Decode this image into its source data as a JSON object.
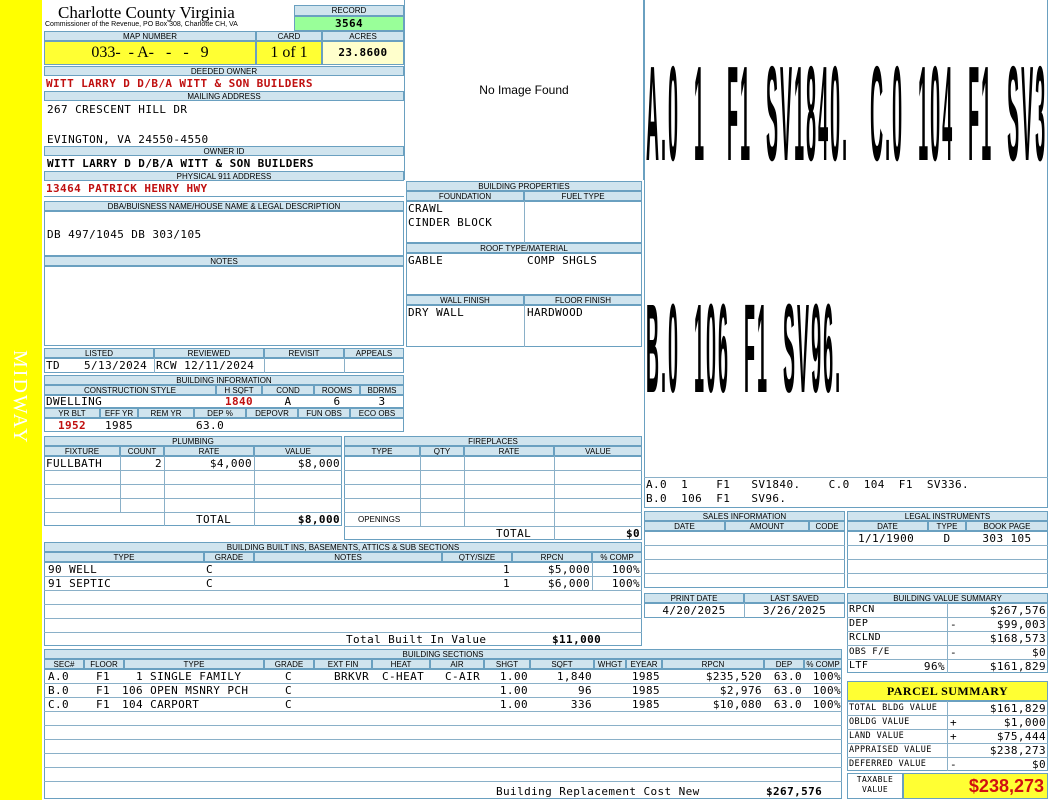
{
  "sidebar_label": "MIDWAY",
  "county_title": "Charlotte County Virginia",
  "commissioner": "Commissioner of the Revenue, PO Box 308, Charlotte CH, VA",
  "record_label": "RECORD",
  "record_value": "3564",
  "map_number_label": "MAP NUMBER",
  "map_number": "033-  - A-   -   -   9",
  "card_label": "CARD",
  "card": "1 of 1",
  "acres_label": "ACRES",
  "acres": "23.8600",
  "deeded_owner_label": "DEEDED OWNER",
  "deeded_owner": "WITT LARRY D D/B/A WITT & SON BUILDERS",
  "mailing_label": "MAILING ADDRESS",
  "mailing_line1": "267 CRESCENT HILL DR",
  "mailing_line2": "EVINGTON, VA 24550-4550",
  "owner_id_label": "OWNER ID",
  "owner_id": "WITT LARRY D D/B/A WITT & SON BUILDERS",
  "physical_label": "PHYSICAL 911 ADDRESS",
  "physical_address": "13464 PATRICK HENRY HWY",
  "dba_label": "DBA/BUISNESS NAME/HOUSE NAME & LEGAL DESCRIPTION",
  "dba_text": "DB 497/1045 DB 303/105",
  "notes_label": "NOTES",
  "no_image": "No Image Found",
  "building_properties": {
    "title": "BUILDING PROPERTIES",
    "foundation_label": "FOUNDATION",
    "fuel_label": "FUEL TYPE",
    "foundation1": "CRAWL",
    "foundation2": "CINDER BLOCK",
    "roof_label": "ROOF TYPE/MATERIAL",
    "roof_type": "GABLE",
    "roof_material": "COMP SHGLS",
    "wall_label": "WALL FINISH",
    "floor_label": "FLOOR FINISH",
    "wall": "DRY WALL",
    "floor": "HARDWOOD"
  },
  "sketch": {
    "row1": "A.0  1   F1  SV1840.   C.0  104  F1  SV336.",
    "row2": "B.0  106  F1  SV96.",
    "caption1": "A.0  1    F1   SV1840.    C.0  104  F1  SV336.",
    "caption2": "B.0  106  F1   SV96."
  },
  "review": {
    "listed_label": "LISTED",
    "reviewed_label": "REVIEWED",
    "revisit_label": "REVISIT",
    "appeals_label": "APPEALS",
    "listed_code": "TD",
    "listed_date": "5/13/2024",
    "reviewed": "RCW 12/11/2024"
  },
  "building_info": {
    "title": "BUILDING INFORMATION",
    "h_style": "CONSTRUCTION STYLE",
    "h_sqft": "H SQFT",
    "h_cond": "COND",
    "h_rooms": "ROOMS",
    "h_bdrms": "BDRMS",
    "style": "DWELLING",
    "sqft": "1840",
    "cond": "A",
    "rooms": "6",
    "bdrms": "3",
    "h_yrblt": "YR BLT",
    "h_effyr": "EFF YR",
    "h_remyr": "REM YR",
    "h_dep": "DEP %",
    "h_depovr": "DEPOVR",
    "h_funobs": "FUN OBS",
    "h_ecoobs": "ECO OBS",
    "yrblt": "1952",
    "effyr": "1985",
    "dep": "63.0"
  },
  "plumbing": {
    "title": "PLUMBING",
    "headers": [
      "FIXTURE",
      "COUNT",
      "RATE",
      "VALUE"
    ],
    "rows": [
      [
        "FULLBATH",
        "2",
        "$4,000",
        "$8,000"
      ]
    ],
    "total_label": "TOTAL",
    "total": "$8,000"
  },
  "fireplaces": {
    "title": "FIREPLACES",
    "headers": [
      "TYPE",
      "QTY",
      "RATE",
      "VALUE"
    ],
    "openings_label": "OPENINGS",
    "total_label": "TOTAL",
    "total": "$0"
  },
  "built_ins": {
    "title": "BUILDING BUILT INS, BASEMENTS, ATTICS & SUB SECTIONS",
    "headers": [
      "TYPE",
      "GRADE",
      "NOTES",
      "QTY/SIZE",
      "RPCN",
      "% COMP"
    ],
    "rows": [
      [
        "90 WELL",
        "C",
        "",
        "1",
        "$5,000",
        "100%"
      ],
      [
        "91 SEPTIC",
        "C",
        "",
        "1",
        "$6,000",
        "100%"
      ]
    ],
    "total_label": "Total Built In Value",
    "total": "$11,000"
  },
  "sales": {
    "title": "SALES INFORMATION",
    "headers": [
      "DATE",
      "AMOUNT",
      "CODE"
    ]
  },
  "legal": {
    "title": "LEGAL INSTRUMENTS",
    "headers": [
      "DATE",
      "TYPE",
      "BOOK PAGE"
    ],
    "rows": [
      [
        "1/1/1900",
        "D",
        "303 105"
      ]
    ]
  },
  "print_date_label": "PRINT DATE",
  "print_date": "4/20/2025",
  "last_saved_label": "LAST SAVED",
  "last_saved": "3/26/2025",
  "bvs": {
    "title": "BUILDING VALUE SUMMARY",
    "rows": [
      {
        "label": "RPCN",
        "sign": "",
        "value": "$267,576"
      },
      {
        "label": "DEP",
        "sign": "-",
        "value": "$99,003"
      },
      {
        "label": "RCLND",
        "sign": "",
        "value": "$168,573"
      },
      {
        "label": "OBS F/E",
        "sign": "-",
        "value": "$0"
      },
      {
        "label": "LTF",
        "pct": "96%",
        "sign": "",
        "value": "$161,829"
      }
    ]
  },
  "parcel": {
    "title": "PARCEL SUMMARY",
    "rows": [
      {
        "label": "TOTAL BLDG VALUE",
        "sign": "",
        "value": "$161,829"
      },
      {
        "label": "OBLDG VALUE",
        "sign": "+",
        "value": "$1,000"
      },
      {
        "label": "LAND VALUE",
        "sign": "+",
        "value": "$75,444"
      },
      {
        "label": "APPRAISED VALUE",
        "sign": "",
        "value": "$238,273"
      },
      {
        "label": "DEFERRED VALUE",
        "sign": "-",
        "value": "$0"
      }
    ],
    "taxable_label1": "TAXABLE",
    "taxable_label2": "VALUE",
    "taxable": "$238,273"
  },
  "sections": {
    "title": "BUILDING SECTIONS",
    "headers": [
      "SEC#",
      "FLOOR",
      "TYPE",
      "GRADE",
      "EXT FIN",
      "HEAT",
      "AIR",
      "SHGT",
      "SQFT",
      "WHGT",
      "EYEAR",
      "RPCN",
      "DEP",
      "% COMP"
    ],
    "rows": [
      [
        "A.0",
        "F1",
        "1 SINGLE FAMILY",
        "C",
        "BRKVR",
        "C-HEAT",
        "C-AIR",
        "1.00",
        "1,840",
        "",
        "1985",
        "$235,520",
        "63.0",
        "100%"
      ],
      [
        "B.0",
        "F1",
        "106 OPEN MSNRY PCH",
        "C",
        "",
        "",
        "",
        "1.00",
        "96",
        "",
        "1985",
        "$2,976",
        "63.0",
        "100%"
      ],
      [
        "C.0",
        "F1",
        "104 CARPORT",
        "C",
        "",
        "",
        "",
        "1.00",
        "336",
        "",
        "1985",
        "$10,080",
        "63.0",
        "100%"
      ]
    ],
    "footer_label": "Building Replacement Cost New",
    "footer_value": "$267,576"
  },
  "colors": {
    "sidebar": "#ffff00",
    "header_bg": "#d0e4ee",
    "record_bg": "#99ff99",
    "highlight": "#ffff33",
    "red_text": "#c01010"
  }
}
